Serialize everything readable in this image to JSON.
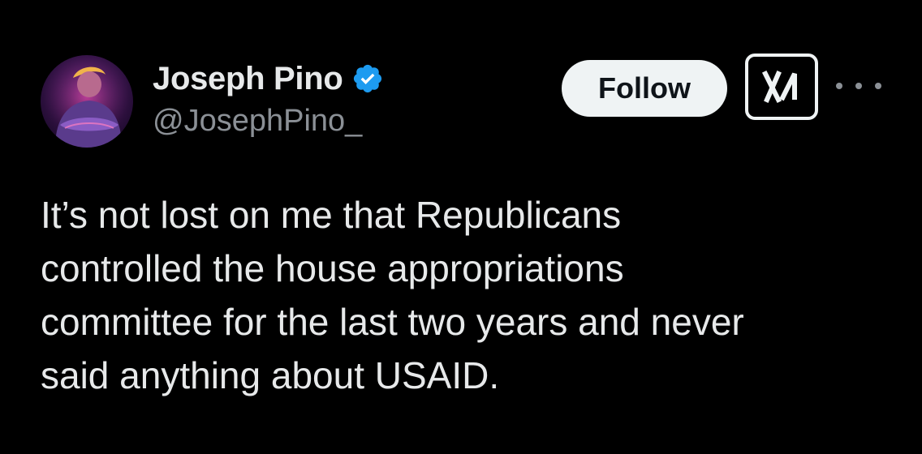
{
  "author": {
    "display_name": "Joseph Pino",
    "handle": "@JosephPino_",
    "verified": true,
    "avatar_icon": "avatar-portrait",
    "verified_icon": "verified-badge-icon"
  },
  "actions": {
    "follow_label": "Follow",
    "grok_icon": "grok-icon",
    "more_icon": "more-options-icon"
  },
  "tweet": {
    "lines": [
      "It’s not lost on me that Republicans",
      "controlled the house appropriations",
      "committee for the last two years and never",
      "said anything about USAID."
    ]
  },
  "colors": {
    "background": "#000000",
    "text_primary": "#e7e9ea",
    "text_secondary": "#8b9096",
    "verified_blue": "#1d9bf0",
    "follow_bg": "#eff3f4",
    "follow_text": "#0f1419"
  }
}
